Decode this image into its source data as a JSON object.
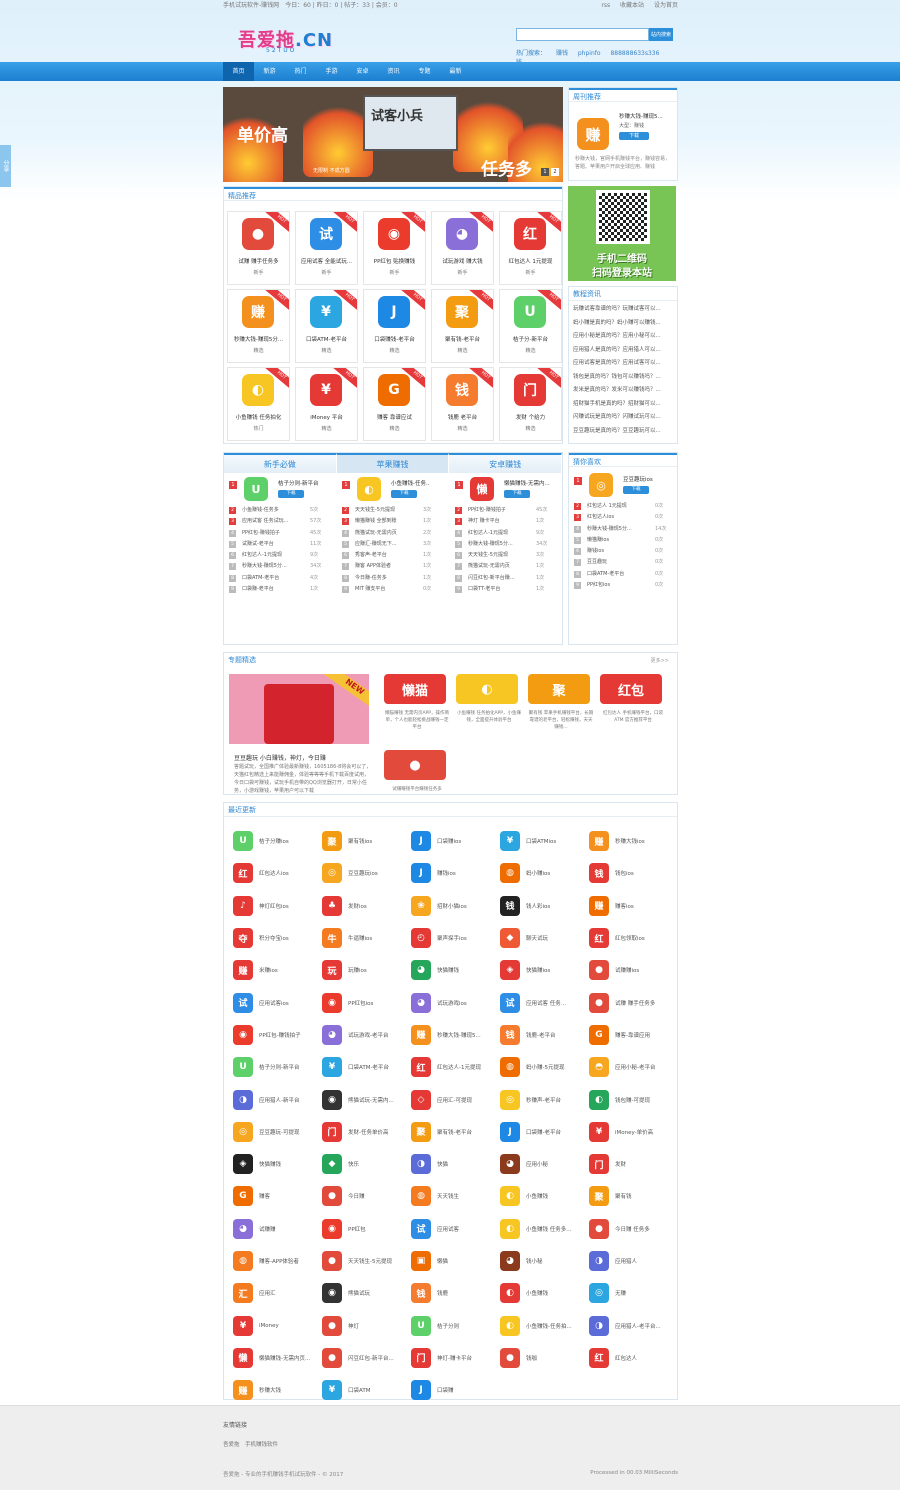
{
  "topbar": {
    "left": "手机试玩软件-赚钱网",
    "stats": "今日：60 | 昨日：0 | 帖子：33 | 会员：0",
    "links": [
      "rss",
      "收藏本站",
      "设为首页"
    ]
  },
  "header": {
    "logo_text": "吾爱拖",
    "logo_suffix": ".CN",
    "logo_sub": "52TUO",
    "search_placeholder": "",
    "search_button": "站内搜索",
    "hot_label": "热门搜索：",
    "hot_words": [
      "赚钱",
      "phpinfo",
      "888888633s336",
      "钱"
    ]
  },
  "nav": [
    "首页",
    "新游",
    "热门",
    "手游",
    "安卓",
    "资讯",
    "专题",
    "最新"
  ],
  "side_tab": "分享",
  "banner": {
    "t1": "单价高",
    "t2": "试客小兵",
    "t3": "任务多",
    "t4": "无限制 不成方圆",
    "pages": [
      "1",
      "2"
    ]
  },
  "weekly": {
    "title": "周刊推荐",
    "app_name": "秒赚大钱-赚现5...",
    "app_type": "大型：赚钱",
    "download": "下载",
    "desc": "秒赚大钱，官网手机赚钱平台，赚钱容易，答题、苹果用户开启全球应用、赚钱"
  },
  "qr": {
    "line1": "手机二维码",
    "line2": "扫码登录本站"
  },
  "news": {
    "title": "教程资讯",
    "items": [
      "玩赚试客靠谱的吗？玩赚试客可以...",
      "蚂小赚是真的吗？蚂小赚可以赚钱...",
      "应用小秘是真的吗？应用小秘可以...",
      "应用猎人是真的吗？应用猎人可以...",
      "应用试客是真的吗？应用试客可以...",
      "钱包是真的吗？钱包可以赚钱吗？...",
      "发米是真的吗？发米可以赚钱吗？...",
      "招财猫手机是真的吗？招财猫可以...",
      "闪赚试玩是真的吗？闪赚试玩可以...",
      "豆豆趣玩是真的吗？豆豆趣玩可以..."
    ]
  },
  "pick": {
    "title": "精品推荐",
    "cards": [
      {
        "name": "试赚 赚手任务多",
        "tag": "新手",
        "icon": "hat-icon",
        "color": "#e24b3c",
        "glyph": "●"
      },
      {
        "name": "应用试客 全能试玩...",
        "tag": "新手",
        "icon": "try-icon",
        "color": "#2e8ee6",
        "glyph": "试"
      },
      {
        "name": "PP红包 贴换赚钱",
        "tag": "新手",
        "icon": "monster-icon",
        "color": "#ea3b2c",
        "glyph": "◉"
      },
      {
        "name": "试玩游戏 赚大钱",
        "tag": "新手",
        "icon": "purple-monster-icon",
        "color": "#8a6fd8",
        "glyph": "◕"
      },
      {
        "name": "红包达人 1元提现",
        "tag": "新手",
        "icon": "hongbao-icon",
        "color": "#e53935",
        "glyph": "红"
      },
      {
        "name": "秒赚大钱-赚现5分...",
        "tag": "精选",
        "icon": "zhuan-icon",
        "color": "#f4901e",
        "glyph": "赚"
      },
      {
        "name": "口袋ATM-老平台",
        "tag": "精选",
        "icon": "atm-icon",
        "color": "#2ba6e0",
        "glyph": "¥"
      },
      {
        "name": "口袋赚钱-老平台",
        "tag": "精选",
        "icon": "koudai-icon",
        "color": "#1e88e5",
        "glyph": "J"
      },
      {
        "name": "聚有钱-老平台",
        "tag": "精选",
        "icon": "ju-icon",
        "color": "#f39c12",
        "glyph": "聚"
      },
      {
        "name": "桔子分-新平台",
        "tag": "精选",
        "icon": "orange-u-icon",
        "color": "#5ed06a",
        "glyph": "U"
      },
      {
        "name": "小鱼赚钱 任务拍化",
        "tag": "热门",
        "icon": "fish-icon",
        "color": "#f7c623",
        "glyph": "◐"
      },
      {
        "name": "iMoney 平台",
        "tag": "精选",
        "icon": "imoney-icon",
        "color": "#e53935",
        "glyph": "¥"
      },
      {
        "name": "赚客 靠谱应试",
        "tag": "精选",
        "icon": "zhuanke-icon",
        "color": "#ef6c00",
        "glyph": "G"
      },
      {
        "name": "钱鹿 老平台",
        "tag": "精选",
        "icon": "qianlu-icon",
        "color": "#f57c2f",
        "glyph": "钱"
      },
      {
        "name": "发财 个给力",
        "tag": "精选",
        "icon": "facai-icon",
        "color": "#e53935",
        "glyph": "门"
      }
    ]
  },
  "tabs3": {
    "tabs": [
      "新手必做",
      "苹果赚钱",
      "安卓赚钱"
    ],
    "cols": [
      {
        "top_name": "桔子分则-新平台",
        "download": "下载",
        "icon": "orange-u-icon",
        "color": "#5ed06a",
        "glyph": "U",
        "items": [
          [
            "小鱼赚钱-任务多",
            "5次"
          ],
          [
            "应用试客 任务试玩...",
            "57次"
          ],
          [
            "PP红包-赚钱拍子",
            "45次"
          ],
          [
            "试赚试-老平台",
            "11次"
          ],
          [
            "红包达人-1元提现",
            "9次"
          ],
          [
            "秒赚大钱-赚现5分...",
            "34次"
          ],
          [
            "口袋ATM-老平台",
            "4次"
          ],
          [
            "口袋赚-老平台",
            "1次"
          ]
        ]
      },
      {
        "top_name": "小鱼赚钱-任务..",
        "download": "下载",
        "icon": "fish-icon",
        "color": "#f7c623",
        "glyph": "◐",
        "items": [
          [
            "天天钱生-5元提现",
            "3次"
          ],
          [
            "懒猫赚钱 全部到账",
            "1次"
          ],
          [
            "熊猫试玩-无需内页",
            "2次"
          ],
          [
            "应赚汇-赚现无下...",
            "3次"
          ],
          [
            "秀客声-老平台",
            "1次"
          ],
          [
            "赚客 APP体验者",
            "1次"
          ],
          [
            "今日赚-任务多",
            "1次"
          ],
          [
            "MIT 赚支平台",
            "0次"
          ]
        ]
      },
      {
        "top_name": "懒猫赚钱-无需内...",
        "download": "下载",
        "icon": "lanmao-icon",
        "color": "#e53935",
        "glyph": "懒",
        "items": [
          [
            "PP红包-赚钱拍子",
            "45次"
          ],
          [
            "神灯 赚卡平台",
            "1次"
          ],
          [
            "红包达人-1元提现",
            "9次"
          ],
          [
            "秒赚大钱-赚现5分...",
            "34次"
          ],
          [
            "天天钱生-5元提现",
            "3次"
          ],
          [
            "熊猫试玩-无需内页",
            "1次"
          ],
          [
            "闪豆红包-新平台赚...",
            "1次"
          ],
          [
            "口袋TT-老平台",
            "1次"
          ]
        ]
      }
    ]
  },
  "guess": {
    "title": "猜你喜欢",
    "top_name": "豆豆趣玩ios",
    "download": "下载",
    "icon": "doudou-icon",
    "color": "#f7a620",
    "glyph": "◎",
    "items": [
      [
        "红包达人 1元提现",
        "0次"
      ],
      [
        "红包达人ios",
        "0次"
      ],
      [
        "秒赚大钱-赚现5分...",
        "14次"
      ],
      [
        "懒猫赚ios",
        "0次"
      ],
      [
        "赚钱ios",
        "0次"
      ],
      [
        "豆豆趣玩",
        "0次"
      ],
      [
        "口袋ATM-老平台",
        "0次"
      ],
      [
        "PP红包ios",
        "0次"
      ]
    ]
  },
  "topic": {
    "title": "专题精选",
    "more": "更多>>",
    "big_title": "豆豆趣玩 小白赚钱，神灯，今日赚",
    "big_desc": "答题试玩，全国推广体验最新赚钱，1605186-8将会可以了，天猫红包精选上来能赚佣金，体验等等等手机下载百度试用，今日口袋可赚钱，试玩手机自带的QQ浏览器打开，日常小任务，小游戏赚钱，苹果用户可以下载",
    "items": [
      {
        "desc": "懒猫赚钱 无需内页APP，操作简单，个人也能轻松挑战赚钱一定平台",
        "color": "#e53935",
        "glyph": "懒猫"
      },
      {
        "desc": "小鱼赚钱 任务拍化APP，小鱼赚钱，全面提升体验平台",
        "color": "#f7c623",
        "glyph": "◐"
      },
      {
        "desc": "聚有钱 苹果手机赚钱平台，长期靠谱的老平台，轻松赚钱，天天赚钱...",
        "color": "#f39c12",
        "glyph": "聚"
      },
      {
        "desc": "红包达人 手机赚钱平台，口袋ATM 官方推荐平台",
        "color": "#e53935",
        "glyph": "红包"
      },
      {
        "desc": "试赚赚钱平台赚钱任务多",
        "color": "#e24b3c",
        "glyph": "●"
      }
    ]
  },
  "recent": {
    "title": "最近更新",
    "items": [
      [
        "桔子分赚ios",
        "#5ed06a",
        "U"
      ],
      [
        "聚有钱ios",
        "#f39c12",
        "聚"
      ],
      [
        "口袋赚ios",
        "#1e88e5",
        "J"
      ],
      [
        "口袋ATMios",
        "#2ba6e0",
        "¥"
      ],
      [
        "秒赚大钱ios",
        "#f4901e",
        "赚"
      ],
      [
        "红包达人ios",
        "#e53935",
        "红"
      ],
      [
        "豆豆趣玩ios",
        "#f7a620",
        "◎"
      ],
      [
        "赚钱ios",
        "#1e88e5",
        "J"
      ],
      [
        "蚂小赚ios",
        "#ef6c00",
        "◍"
      ],
      [
        "钱包ios",
        "#e53935",
        "钱"
      ],
      [
        "神灯红包ios",
        "#e53935",
        "♪"
      ],
      [
        "发财ios",
        "#e53935",
        "♣"
      ],
      [
        "招财小猫ios",
        "#f7a620",
        "❀"
      ],
      [
        "钱人彩ios",
        "#222",
        "钱"
      ],
      [
        "赚客ios",
        "#ef6c00",
        "赚"
      ],
      [
        "积分夺宝ios",
        "#e53935",
        "夺"
      ],
      [
        "牛逼赚ios",
        "#f47b20",
        "牛"
      ],
      [
        "聚声探手ios",
        "#e53935",
        "◴"
      ],
      [
        "聊天试玩",
        "#ef5a34",
        "◆"
      ],
      [
        "红包领取ios",
        "#e53935",
        "红"
      ],
      [
        "米赚ios",
        "#e53935",
        "赚"
      ],
      [
        "玩赚ios",
        "#e53935",
        "玩"
      ],
      [
        "快猫赚钱",
        "#26a65b",
        "◕"
      ],
      [
        "快猫赚ios",
        "#e53935",
        "◈"
      ],
      [
        "试赚赚ios",
        "#e24b3c",
        "●"
      ],
      [
        "应用试客ios",
        "#2e8ee6",
        "试"
      ],
      [
        "PP红包ios",
        "#ea3b2c",
        "◉"
      ],
      [
        "试玩游戏ios",
        "#8a6fd8",
        "◕"
      ],
      [
        "应用试客 任务...",
        "#2e8ee6",
        "试"
      ],
      [
        "试赚 赚手任务多",
        "#e24b3c",
        "●"
      ],
      [
        "PP红包-赚钱拍子",
        "#ea3b2c",
        "◉"
      ],
      [
        "试玩游戏-老平台",
        "#8a6fd8",
        "◕"
      ],
      [
        "秒赚大钱-赚现5...",
        "#f4901e",
        "赚"
      ],
      [
        "钱鹿-老平台",
        "#f57c2f",
        "钱"
      ],
      [
        "赚客-靠谱应用",
        "#ef6c00",
        "G"
      ],
      [
        "桔子分则-新平台",
        "#5ed06a",
        "U"
      ],
      [
        "口袋ATM-老平台",
        "#2ba6e0",
        "¥"
      ],
      [
        "红包达人-1元提现",
        "#e53935",
        "红"
      ],
      [
        "蚂小赚-5元提现",
        "#ef6c00",
        "◍"
      ],
      [
        "应用小秘-老平台",
        "#f7a620",
        "◓"
      ],
      [
        "应用猎人-新平台",
        "#5b6bd8",
        "◑"
      ],
      [
        "熊猫试玩-无需内...",
        "#333",
        "◉"
      ],
      [
        "应用汇-可提现",
        "#e53935",
        "◇"
      ],
      [
        "秒赚声-老平台",
        "#f7c623",
        "◎"
      ],
      [
        "钱包赚-可提现",
        "#26a65b",
        "◐"
      ],
      [
        "豆豆趣玩-可提现",
        "#f7a620",
        "◎"
      ],
      [
        "发财-任务单价高",
        "#e53935",
        "门"
      ],
      [
        "聚有钱-老平台",
        "#f39c12",
        "聚"
      ],
      [
        "口袋赚-老平台",
        "#1e88e5",
        "J"
      ],
      [
        "iMoney-单价高",
        "#e53935",
        "¥"
      ],
      [
        "快猫赚钱",
        "#222",
        "◈"
      ],
      [
        "快乐",
        "#26a65b",
        "◆"
      ],
      [
        "快猫",
        "#5b6bd8",
        "◑"
      ],
      [
        "应用小秘",
        "#8b3a1e",
        "◕"
      ],
      [
        "发财",
        "#e53935",
        "门"
      ],
      [
        "赚客",
        "#ef6c00",
        "G"
      ],
      [
        "今日赚",
        "#e24b3c",
        "●"
      ],
      [
        "天天钱生",
        "#f47b20",
        "◍"
      ],
      [
        "小鱼赚钱",
        "#f7c623",
        "◐"
      ],
      [
        "聚有钱",
        "#f39c12",
        "聚"
      ],
      [
        "试赚赚",
        "#8a6fd8",
        "◕"
      ],
      [
        "PP红包",
        "#ea3b2c",
        "◉"
      ],
      [
        "应用试客",
        "#2e8ee6",
        "试"
      ],
      [
        "小鱼赚钱 任务多...",
        "#f7c623",
        "◐"
      ],
      [
        "今日赚 任务多",
        "#e24b3c",
        "●"
      ],
      [
        "赚客-APP体验者",
        "#f47b20",
        "◍"
      ],
      [
        "天天钱生-5元提现",
        "#e24b3c",
        "●"
      ],
      [
        "懒猫",
        "#ef6c00",
        "▣"
      ],
      [
        "钱小秘",
        "#8b3a1e",
        "◕"
      ],
      [
        "应用猎人",
        "#5b6bd8",
        "◑"
      ],
      [
        "应用汇",
        "#f47b20",
        "汇"
      ],
      [
        "熊猫试玩",
        "#333",
        "◉"
      ],
      [
        "钱鹿",
        "#f57c2f",
        "钱"
      ],
      [
        "小鱼赚钱",
        "#e53935",
        "◐"
      ],
      [
        "无赚",
        "#2ba6e0",
        "◎"
      ],
      [
        "iMoney",
        "#e53935",
        "¥"
      ],
      [
        "神灯",
        "#e24b3c",
        "●"
      ],
      [
        "桔子分则",
        "#5ed06a",
        "U"
      ],
      [
        "小鱼赚钱-任务拍...",
        "#f7c623",
        "◐"
      ],
      [
        "应用猎人-老平台...",
        "#5b6bd8",
        "◑"
      ],
      [
        "懒猫赚钱-无需内页...",
        "#e53935",
        "懒"
      ],
      [
        "闪豆红包-新平台...",
        "#e24b3c",
        "●"
      ],
      [
        "神灯-赚卡平台",
        "#e53935",
        "门"
      ],
      [
        "钱咖",
        "#e24b3c",
        "●"
      ],
      [
        "红包达人",
        "#e53935",
        "红"
      ],
      [
        "秒赚大钱",
        "#f4901e",
        "赚"
      ],
      [
        "口袋ATM",
        "#2ba6e0",
        "¥"
      ],
      [
        "口袋赚",
        "#1e88e5",
        "J"
      ]
    ]
  },
  "footer": {
    "links_title": "友情链接",
    "links": "吾爱拖　手机赚钱软件",
    "copyright": "吾爱拖 - 专业的手机赚钱手机试玩软件 - © 2017",
    "processed": "Processed in 00.03 MilliSeconds"
  }
}
